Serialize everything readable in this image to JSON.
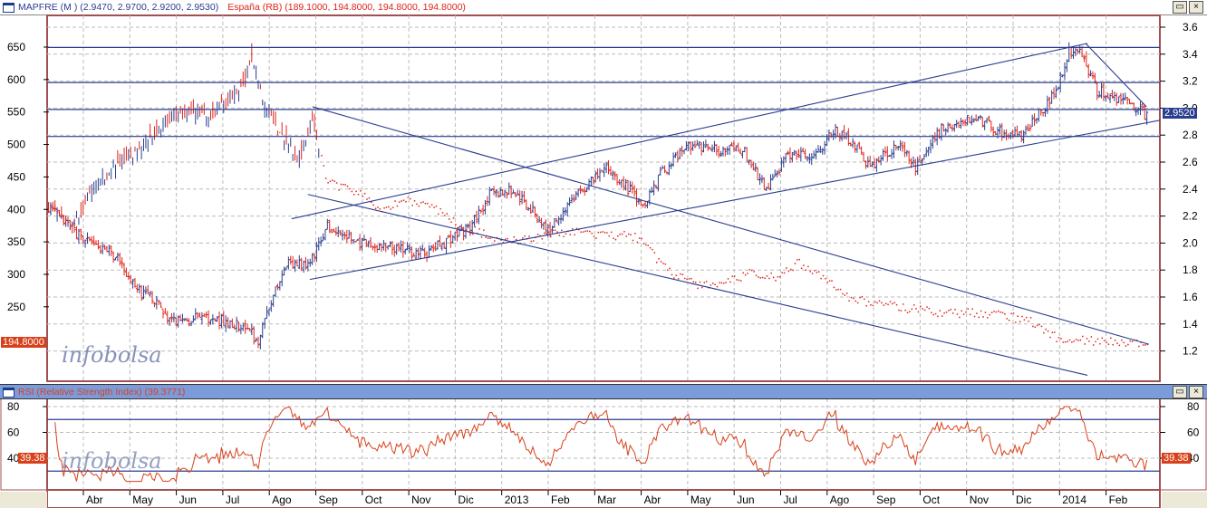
{
  "main_pane": {
    "legend_mapfre": "MAPFRE (M ) (2.9470, 2.9700, 2.9200, 2.9530)",
    "legend_espana": "España (RB) (189.1000, 194.8000, 194.8000, 194.8000)",
    "current_price_badge": "2.9520",
    "espana_badge": "194.8000",
    "watermark": "infobolsa",
    "restore_button": "▭",
    "close_button": "×"
  },
  "rsi_pane": {
    "title": "RSI (Relative Strength Index) (39.3771)",
    "badge_left": "39.38",
    "badge_right": "39.38",
    "watermark": "infobolsa",
    "restore_button": "▭",
    "close_button": "×"
  },
  "colors": {
    "up": "#2a3d8f",
    "down": "#e0231a",
    "line": "#2a3d8f",
    "rsi": "#d9401a",
    "frame": "#a05050",
    "rsi_header": "#7b9bdb"
  },
  "chart_data": [
    {
      "type": "bar",
      "title": "MAPFRE (M)",
      "axis": "right",
      "x_unit": "months since 2012-04-01",
      "yticks": [
        "3.6",
        "3.4",
        "3.2",
        "3.0",
        "2.8",
        "2.6",
        "2.4",
        "2.2",
        "2.0",
        "1.8",
        "1.6",
        "1.4",
        "1.2"
      ],
      "anchors": [
        [
          -0.72,
          2.26
        ],
        [
          -0.33,
          2.12
        ],
        [
          0.16,
          1.99
        ],
        [
          0.74,
          1.89
        ],
        [
          1.13,
          1.65
        ],
        [
          1.52,
          1.59
        ],
        [
          1.91,
          1.42
        ],
        [
          2.69,
          1.45
        ],
        [
          3.47,
          1.38
        ],
        [
          3.76,
          1.28
        ],
        [
          4.05,
          1.59
        ],
        [
          4.44,
          1.86
        ],
        [
          4.83,
          1.82
        ],
        [
          5.22,
          2.12
        ],
        [
          6.0,
          1.99
        ],
        [
          6.78,
          1.95
        ],
        [
          7.37,
          1.92
        ],
        [
          7.95,
          2.05
        ],
        [
          8.34,
          2.12
        ],
        [
          8.73,
          2.36
        ],
        [
          9.22,
          2.39
        ],
        [
          9.61,
          2.26
        ],
        [
          10.0,
          2.09
        ],
        [
          10.49,
          2.32
        ],
        [
          11.27,
          2.56
        ],
        [
          11.85,
          2.36
        ],
        [
          12.05,
          2.29
        ],
        [
          12.44,
          2.52
        ],
        [
          13.02,
          2.73
        ],
        [
          13.6,
          2.69
        ],
        [
          14.19,
          2.69
        ],
        [
          14.68,
          2.39
        ],
        [
          15.17,
          2.66
        ],
        [
          15.75,
          2.66
        ],
        [
          16.14,
          2.83
        ],
        [
          16.53,
          2.76
        ],
        [
          16.92,
          2.56
        ],
        [
          17.5,
          2.73
        ],
        [
          17.9,
          2.56
        ],
        [
          18.48,
          2.86
        ],
        [
          19.26,
          2.93
        ],
        [
          19.65,
          2.83
        ],
        [
          20.23,
          2.79
        ],
        [
          20.62,
          2.99
        ],
        [
          20.92,
          3.13
        ],
        [
          21.21,
          3.43
        ],
        [
          21.5,
          3.4
        ],
        [
          21.79,
          3.13
        ],
        [
          22.38,
          3.06
        ],
        [
          22.87,
          2.95
        ]
      ],
      "hlines": [
        3.45,
        3.19,
        2.99,
        2.79
      ],
      "trendlines": [
        [
          4.48,
          2.18,
          21.6,
          3.48
        ],
        [
          4.87,
          1.73,
          23.16,
          2.91
        ],
        [
          4.93,
          3.01,
          22.92,
          1.25
        ],
        [
          4.83,
          2.36,
          21.6,
          1.02
        ],
        [
          21.56,
          3.48,
          22.87,
          3.01
        ]
      ],
      "last": 2.952
    },
    {
      "type": "line",
      "title": "España (RB)",
      "axis": "left",
      "style": "bars-then-dots",
      "x_unit": "months since 2012-04-01",
      "yticks": [
        "650",
        "600",
        "550",
        "500",
        "450",
        "400",
        "350",
        "300",
        "250"
      ],
      "anchors": [
        [
          -0.72,
          402
        ],
        [
          -0.23,
          374
        ],
        [
          0.16,
          430
        ],
        [
          0.74,
          471
        ],
        [
          1.13,
          485
        ],
        [
          1.52,
          513
        ],
        [
          1.91,
          541
        ],
        [
          2.3,
          555
        ],
        [
          2.69,
          541
        ],
        [
          2.88,
          555
        ],
        [
          3.18,
          569
        ],
        [
          3.47,
          597
        ],
        [
          3.63,
          639
        ],
        [
          3.86,
          569
        ],
        [
          4.05,
          541
        ],
        [
          4.44,
          499
        ],
        [
          4.64,
          478
        ],
        [
          4.93,
          541
        ],
        [
          5.22,
          444
        ],
        [
          5.81,
          430
        ],
        [
          6.39,
          402
        ],
        [
          6.98,
          416
        ],
        [
          7.56,
          402
        ],
        [
          8.15,
          374
        ],
        [
          8.73,
          360
        ],
        [
          9.32,
          353
        ],
        [
          9.9,
          360
        ],
        [
          10.49,
          367
        ],
        [
          11.07,
          360
        ],
        [
          11.85,
          360
        ],
        [
          12.24,
          332
        ],
        [
          12.63,
          304
        ],
        [
          13.22,
          283
        ],
        [
          13.8,
          290
        ],
        [
          14.39,
          304
        ],
        [
          14.97,
          297
        ],
        [
          15.36,
          318
        ],
        [
          15.94,
          297
        ],
        [
          16.53,
          262
        ],
        [
          17.11,
          255
        ],
        [
          17.7,
          248
        ],
        [
          18.67,
          241
        ],
        [
          19.65,
          241
        ],
        [
          20.43,
          227
        ],
        [
          21.01,
          199
        ],
        [
          21.6,
          199
        ],
        [
          22.18,
          199
        ],
        [
          22.87,
          193
        ]
      ],
      "last": 194.8
    },
    {
      "type": "line",
      "title": "RSI (Relative Strength Index)",
      "period": 14,
      "yticks": [
        "80",
        "60",
        "40"
      ],
      "levels": [
        70,
        30
      ],
      "ylim": [
        20,
        80
      ],
      "last": 39.3771
    }
  ],
  "x_axis": {
    "ticks": [
      {
        "label": "Abr",
        "t": 0
      },
      {
        "label": "May",
        "t": 1
      },
      {
        "label": "Jun",
        "t": 2
      },
      {
        "label": "Jul",
        "t": 3
      },
      {
        "label": "Ago",
        "t": 4
      },
      {
        "label": "Sep",
        "t": 5
      },
      {
        "label": "Oct",
        "t": 6
      },
      {
        "label": "Nov",
        "t": 7
      },
      {
        "label": "Dic",
        "t": 8
      },
      {
        "label": "2013",
        "t": 9
      },
      {
        "label": "Feb",
        "t": 10
      },
      {
        "label": "Mar",
        "t": 11
      },
      {
        "label": "Abr",
        "t": 12
      },
      {
        "label": "May",
        "t": 13
      },
      {
        "label": "Jun",
        "t": 14
      },
      {
        "label": "Jul",
        "t": 15
      },
      {
        "label": "Ago",
        "t": 16
      },
      {
        "label": "Sep",
        "t": 17
      },
      {
        "label": "Oct",
        "t": 18
      },
      {
        "label": "Nov",
        "t": 19
      },
      {
        "label": "Dic",
        "t": 20
      },
      {
        "label": "2014",
        "t": 21
      },
      {
        "label": "Feb",
        "t": 22
      }
    ]
  }
}
